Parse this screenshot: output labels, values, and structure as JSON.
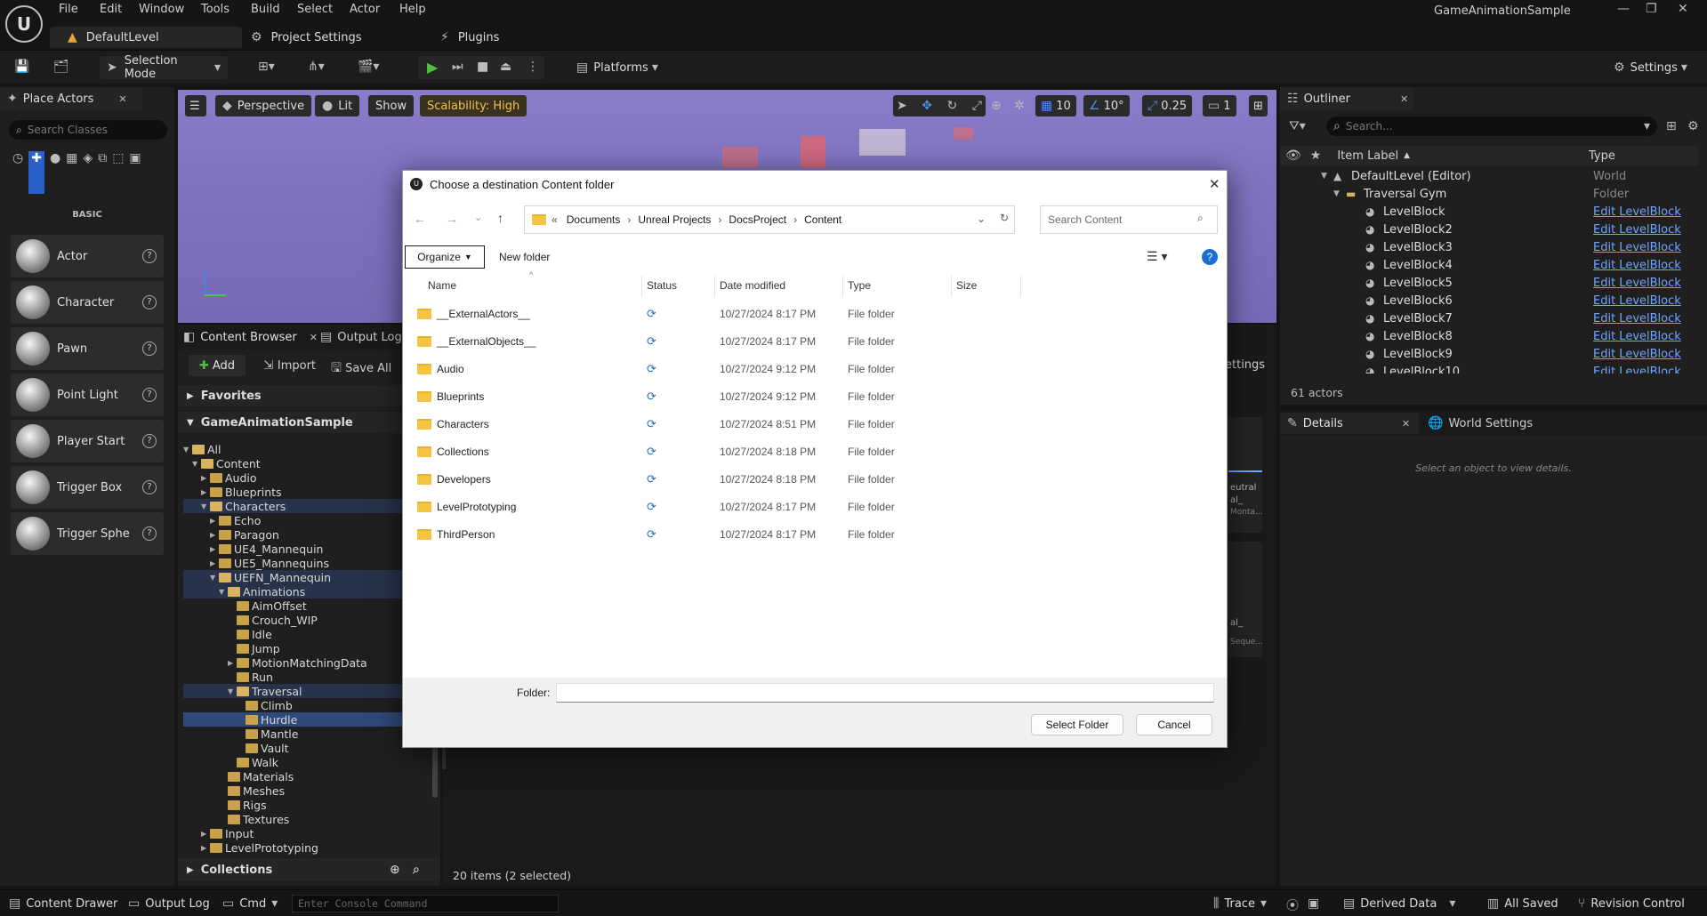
{
  "app": {
    "window_title": "GameAnimationSample",
    "menu": [
      "File",
      "Edit",
      "Window",
      "Tools",
      "Build",
      "Select",
      "Actor",
      "Help"
    ],
    "doc_tabs": [
      "DefaultLevel",
      "Project Settings",
      "Plugins"
    ]
  },
  "toolbar": {
    "selection_mode": "Selection Mode",
    "platforms": "Platforms",
    "settings": "Settings"
  },
  "place_actors": {
    "title": "Place Actors",
    "search_placeholder": "Search Classes",
    "category": "BASIC",
    "items": [
      "Actor",
      "Character",
      "Pawn",
      "Point Light",
      "Player Start",
      "Trigger Box",
      "Trigger Sphe"
    ]
  },
  "viewport": {
    "perspective": "Perspective",
    "lit": "Lit",
    "show": "Show",
    "scalability": "Scalability: High",
    "grid": "10",
    "rot": "10°",
    "scale": "0.25",
    "cam": "1"
  },
  "content_browser": {
    "tab": "Content Browser",
    "tab2": "Output Log",
    "add": "Add",
    "import": "Import",
    "save_all": "Save All",
    "favorites": "Favorites",
    "root": "GameAnimationSample",
    "collections": "Collections",
    "settings_frag": "ettings",
    "item_count": "20 items (2 selected)",
    "tree": [
      {
        "label": "All",
        "d": 0,
        "open": true
      },
      {
        "label": "Content",
        "d": 1,
        "open": true
      },
      {
        "label": "Audio",
        "d": 2
      },
      {
        "label": "Blueprints",
        "d": 2
      },
      {
        "label": "Characters",
        "d": 2,
        "open": true
      },
      {
        "label": "Echo",
        "d": 3
      },
      {
        "label": "Paragon",
        "d": 3
      },
      {
        "label": "UE4_Mannequin",
        "d": 3
      },
      {
        "label": "UE5_Mannequins",
        "d": 3
      },
      {
        "label": "UEFN_Mannequin",
        "d": 3,
        "open": true
      },
      {
        "label": "Animations",
        "d": 4,
        "open": true
      },
      {
        "label": "AimOffset",
        "d": 5
      },
      {
        "label": "Crouch_WIP",
        "d": 5
      },
      {
        "label": "Idle",
        "d": 5
      },
      {
        "label": "Jump",
        "d": 5
      },
      {
        "label": "MotionMatchingData",
        "d": 5
      },
      {
        "label": "Run",
        "d": 5
      },
      {
        "label": "Traversal",
        "d": 5,
        "open": true
      },
      {
        "label": "Climb",
        "d": 6
      },
      {
        "label": "Hurdle",
        "d": 6
      },
      {
        "label": "Mantle",
        "d": 6
      },
      {
        "label": "Vault",
        "d": 6
      },
      {
        "label": "Walk",
        "d": 5
      },
      {
        "label": "Materials",
        "d": 4
      },
      {
        "label": "Meshes",
        "d": 4
      },
      {
        "label": "Rigs",
        "d": 4
      },
      {
        "label": "Textures",
        "d": 4
      },
      {
        "label": "Input",
        "d": 2
      },
      {
        "label": "LevelPrototyping",
        "d": 2
      }
    ],
    "tile_frags": [
      "eutral",
      "al_",
      "Monta...",
      "al_",
      "Seque..."
    ]
  },
  "outliner": {
    "title": "Outliner",
    "search_placeholder": "Search...",
    "col_label": "Item Label",
    "col_type": "Type",
    "rows": [
      {
        "label": "DefaultLevel (Editor)",
        "type": "World"
      },
      {
        "label": "Traversal Gym",
        "type": "Folder"
      },
      {
        "label": "LevelBlock",
        "type": "Edit LevelBlock"
      },
      {
        "label": "LevelBlock2",
        "type": "Edit LevelBlock"
      },
      {
        "label": "LevelBlock3",
        "type": "Edit LevelBlock"
      },
      {
        "label": "LevelBlock4",
        "type": "Edit LevelBlock"
      },
      {
        "label": "LevelBlock5",
        "type": "Edit LevelBlock"
      },
      {
        "label": "LevelBlock6",
        "type": "Edit LevelBlock"
      },
      {
        "label": "LevelBlock7",
        "type": "Edit LevelBlock"
      },
      {
        "label": "LevelBlock8",
        "type": "Edit LevelBlock"
      },
      {
        "label": "LevelBlock9",
        "type": "Edit LevelBlock"
      },
      {
        "label": "LevelBlock10",
        "type": "Edit LevelBlock"
      }
    ],
    "count": "61 actors"
  },
  "details": {
    "tab": "Details",
    "tab2": "World Settings",
    "empty": "Select an object to view details."
  },
  "dialog": {
    "title": "Choose a destination Content folder",
    "breadcrumb": [
      "Documents",
      "Unreal Projects",
      "DocsProject",
      "Content"
    ],
    "search_placeholder": "Search Content",
    "organize": "Organize",
    "new_folder": "New folder",
    "columns": [
      "Name",
      "Status",
      "Date modified",
      "Type",
      "Size"
    ],
    "files": [
      {
        "name": "__ExternalActors__",
        "date": "10/27/2024 8:17 PM",
        "type": "File folder"
      },
      {
        "name": "__ExternalObjects__",
        "date": "10/27/2024 8:17 PM",
        "type": "File folder"
      },
      {
        "name": "Audio",
        "date": "10/27/2024 9:12 PM",
        "type": "File folder"
      },
      {
        "name": "Blueprints",
        "date": "10/27/2024 9:12 PM",
        "type": "File folder"
      },
      {
        "name": "Characters",
        "date": "10/27/2024 8:51 PM",
        "type": "File folder"
      },
      {
        "name": "Collections",
        "date": "10/27/2024 8:18 PM",
        "type": "File folder"
      },
      {
        "name": "Developers",
        "date": "10/27/2024 8:18 PM",
        "type": "File folder"
      },
      {
        "name": "LevelPrototyping",
        "date": "10/27/2024 8:17 PM",
        "type": "File folder"
      },
      {
        "name": "ThirdPerson",
        "date": "10/27/2024 8:17 PM",
        "type": "File folder"
      }
    ],
    "folder_label": "Folder:",
    "folder_value": "",
    "select_btn": "Select Folder",
    "cancel_btn": "Cancel"
  },
  "statusbar": {
    "content_drawer": "Content Drawer",
    "output_log": "Output Log",
    "cmd": "Cmd",
    "console_placeholder": "Enter Console Command",
    "trace": "Trace",
    "derived_data": "Derived Data",
    "all_saved": "All Saved",
    "revision_control": "Revision Control"
  }
}
